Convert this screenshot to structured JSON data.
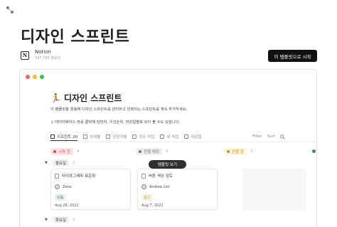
{
  "page": {
    "title": "디자인 스프린트",
    "author_name": "Notion",
    "author_sub": "347,780 철률되",
    "cta_label": "이 템플릿으로 시작"
  },
  "window_dot_colors": [
    "#ff5f57",
    "#febc2e",
    "#28c840"
  ],
  "database": {
    "icon": "🏃",
    "title": "디자인 스프린트",
    "description": "이 템플릿을 활용해 디자인 스프린트를 관리하고 반복되는 스프린트를 계속 추가하세요.",
    "hint": "↓ 데이터베이스 뷰를 클릭해 담당자, 우선순위, 마감일별로 모아 볼 수도 있습니다."
  },
  "tabs": [
    {
      "label": "스프린트 20",
      "icon": "table-icon",
      "active": true
    },
    {
      "label": "상태별",
      "icon": "board-icon",
      "active": false
    },
    {
      "label": "담당자별",
      "icon": "person-icon",
      "active": false
    },
    {
      "label": "모든 작업",
      "icon": "list-icon",
      "active": false
    },
    {
      "label": "내 작업",
      "icon": "list-icon",
      "active": false
    },
    {
      "label": "마감일",
      "icon": "calendar-icon",
      "active": false
    }
  ],
  "toolbar": {
    "filter": "Filter",
    "sort": "Sort"
  },
  "columns": [
    {
      "label": "시작 전",
      "count": "4",
      "bg": "#fbe4e4",
      "color": "#d44c47"
    },
    {
      "label": "진행 예정",
      "count": "0",
      "bg": "#eeeeec",
      "color": "#787774"
    },
    {
      "label": "진행 중",
      "count": "2",
      "bg": "#fbf3db",
      "color": "#cb912f"
    }
  ],
  "groups": [
    {
      "label": "월요일",
      "count": "2"
    },
    {
      "label": "화요일",
      "count": "2"
    }
  ],
  "cards": [
    {
      "title": "타이포그래피 표준화",
      "person": "Zeno",
      "priority": "낮음",
      "priority_bg": "#e8f3e6",
      "priority_color": "#448361",
      "date": "Aug 28, 2022"
    },
    {
      "title": "버튼 색상 검토",
      "person": "Andrea Lim",
      "priority": "중간",
      "priority_bg": "#fbf3db",
      "priority_color": "#cb912f",
      "date": "Aug 7, 2022"
    }
  ],
  "tooltip": "템플릿 보기"
}
